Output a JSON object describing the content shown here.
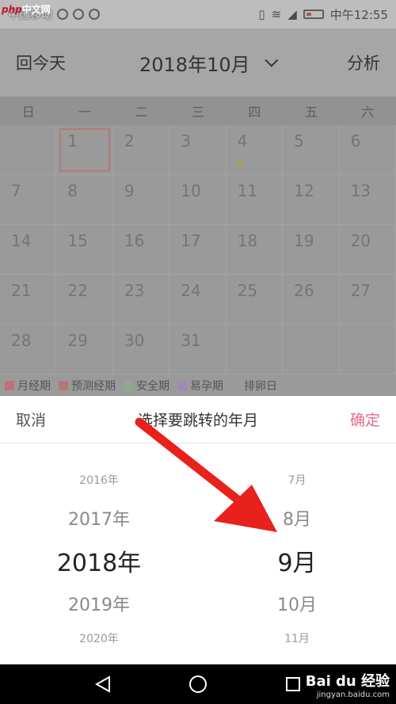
{
  "status_bar": {
    "watermark_php": "php",
    "watermark_cn": "中文网",
    "time": "中午12:55",
    "carrier": "中国移动"
  },
  "header": {
    "today_button": "回今天",
    "month_title": "2018年10月",
    "analyze_button": "分析"
  },
  "calendar": {
    "weekdays": [
      "日",
      "一",
      "二",
      "三",
      "四",
      "五",
      "六"
    ],
    "weeks": [
      [
        "",
        "1",
        "2",
        "3",
        "4",
        "5",
        "6"
      ],
      [
        "7",
        "8",
        "9",
        "10",
        "11",
        "12",
        "13"
      ],
      [
        "14",
        "15",
        "16",
        "17",
        "18",
        "19",
        "20"
      ],
      [
        "21",
        "22",
        "23",
        "24",
        "25",
        "26",
        "27"
      ],
      [
        "28",
        "29",
        "30",
        "31",
        "",
        "",
        ""
      ]
    ],
    "today_label": "1",
    "marker_on_4": "2"
  },
  "legend": {
    "items": [
      {
        "label": "月经期",
        "color": "#c0707a"
      },
      {
        "label": "预测经期",
        "color": "#b07a7a"
      },
      {
        "label": "安全期",
        "color": "#8fa88f"
      },
      {
        "label": "易孕期",
        "color": "#a08ab0"
      },
      {
        "label": "排卵日",
        "color": "#9a9a9a"
      }
    ]
  },
  "picker": {
    "cancel": "取消",
    "title": "选择要跳转的年月",
    "confirm": "确定",
    "years": [
      "2016年",
      "2017年",
      "2018年",
      "2019年",
      "2020年"
    ],
    "months": [
      "7月",
      "8月",
      "9月",
      "10月",
      "11月"
    ]
  },
  "watermark": {
    "brand": "Bai du 经验",
    "url": "jingyan.baidu.com"
  },
  "colors": {
    "accent": "#e86a8c",
    "arrow": "#e8211d"
  }
}
